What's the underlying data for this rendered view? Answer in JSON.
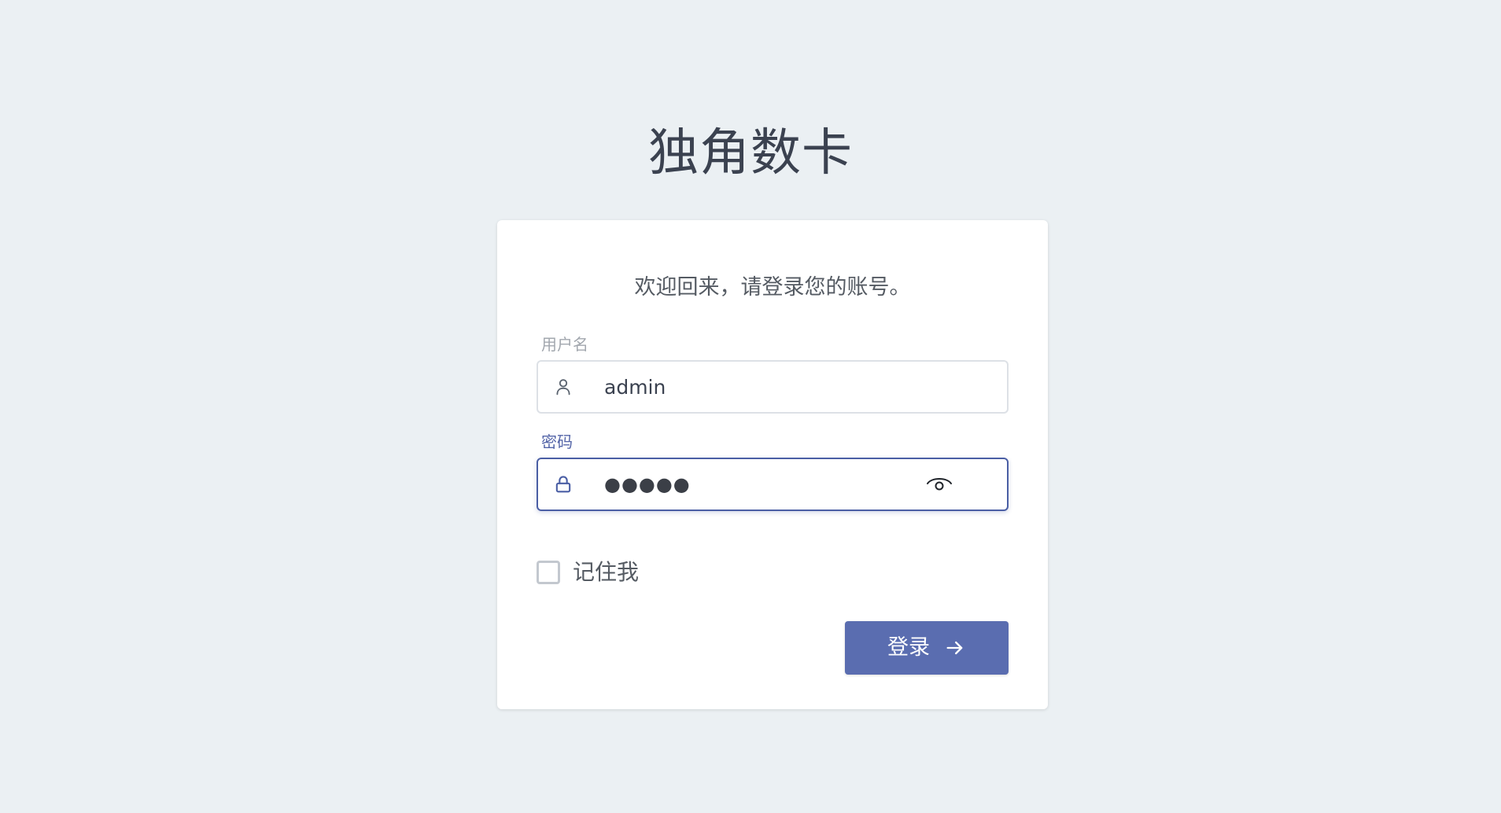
{
  "brand": {
    "title": "独角数卡"
  },
  "login_card": {
    "welcome": "欢迎回来，请登录您的账号。",
    "username": {
      "label": "用户名",
      "value": "admin",
      "icon": "user-icon"
    },
    "password": {
      "label": "密码",
      "masked_value": "●●●●●",
      "icon": "lock-icon",
      "toggle_icon": "eye-icon"
    },
    "remember_me": {
      "label": "记住我",
      "checked": false
    },
    "submit": {
      "label": "登录",
      "icon": "arrow-right-icon"
    }
  },
  "colors": {
    "background": "#ebf0f3",
    "accent": "#5a6db0",
    "focus_border": "#4b5fa5",
    "text": "#3b4250"
  }
}
